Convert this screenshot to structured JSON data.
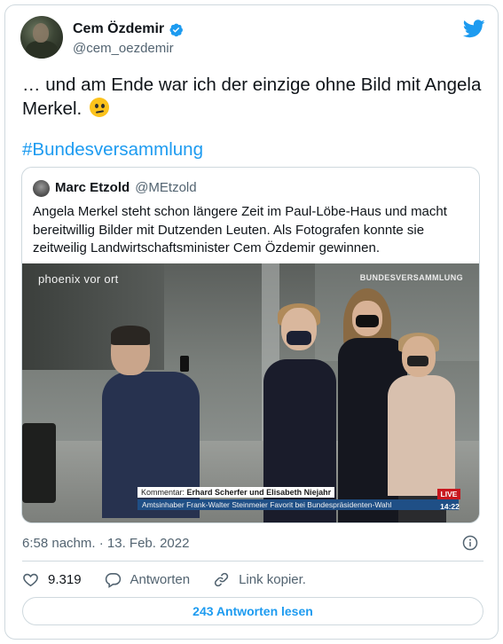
{
  "author": {
    "display_name": "Cem Özdemir",
    "handle": "@cem_oezdemir",
    "verified_icon": "verified-badge-icon"
  },
  "tweet": {
    "text": "… und am Ende war ich der einzige ohne Bild mit Angela Merkel.",
    "emoji": "confused-face-emoji",
    "hashtag": "#Bundesversammlung"
  },
  "quoted": {
    "display_name": "Marc Etzold",
    "handle": "@MEtzold",
    "text": "Angela Merkel steht schon längere Zeit im Paul-Löbe-Haus und macht bereitwillig Bilder mit Dutzenden Leuten. Als Fotografen konnte sie zeitweilig Landwirtschaftsminister Cem Özdemir gewinnen."
  },
  "media": {
    "channel_logo": "phoenix vor ort",
    "channel_sub": "",
    "corner_label": "BUNDESVERSAMMLUNG",
    "lower_third_label": "Kommentar:",
    "lower_third_names": "Erhard Scherfer und Elisabeth Niejahr",
    "lower_third_ticker": "Amtsinhaber Frank-Walter Steinmeier Favorit bei Bundespräsidenten-Wahl",
    "live_badge": "LIVE",
    "clock": "14:22"
  },
  "meta": {
    "timestamp": "6:58 nachm. · 13. Feb. 2022"
  },
  "actions": {
    "likes": "9.319",
    "reply_label": "Antworten",
    "copy_link_label": "Link kopier."
  },
  "read_replies_label": "243 Antworten lesen",
  "colors": {
    "accent": "#1d9bf0",
    "text": "#0f1419",
    "secondary": "#536471",
    "border": "#cfd9de"
  }
}
